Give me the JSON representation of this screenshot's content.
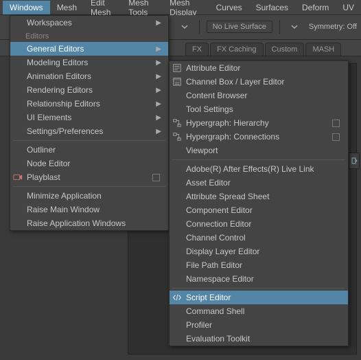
{
  "menubar": {
    "items": [
      {
        "label": "Windows",
        "active": true
      },
      {
        "label": "Mesh"
      },
      {
        "label": "Edit Mesh"
      },
      {
        "label": "Mesh Tools"
      },
      {
        "label": "Mesh Display"
      },
      {
        "label": "Curves"
      },
      {
        "label": "Surfaces"
      },
      {
        "label": "Deform"
      },
      {
        "label": "UV"
      }
    ]
  },
  "toolbar": {
    "live_surface": "No Live Surface",
    "symmetry": "Symmetry: Off"
  },
  "shelf": {
    "tabs": [
      "FX",
      "FX Caching",
      "Custom",
      "MASH"
    ]
  },
  "windows_menu": {
    "section_workspaces": "Workspaces",
    "section_editors": "Editors",
    "items_editors": [
      {
        "label": "General Editors",
        "arrow": true,
        "highlight": true
      },
      {
        "label": "Modeling Editors",
        "arrow": true
      },
      {
        "label": "Animation Editors",
        "arrow": true
      },
      {
        "label": "Rendering Editors",
        "arrow": true
      },
      {
        "label": "Relationship Editors",
        "arrow": true
      },
      {
        "label": "UI Elements",
        "arrow": true
      },
      {
        "label": "Settings/Preferences",
        "arrow": true
      }
    ],
    "items_mid": [
      {
        "label": "Outliner"
      },
      {
        "label": "Node Editor"
      },
      {
        "label": "Playblast",
        "option": true,
        "icon": "playblast"
      }
    ],
    "items_bottom": [
      {
        "label": "Minimize Application"
      },
      {
        "label": "Raise Main Window"
      },
      {
        "label": "Raise Application Windows"
      }
    ]
  },
  "general_editors_menu": {
    "items_top": [
      {
        "label": "Attribute Editor",
        "icon": "attr-editor"
      },
      {
        "label": "Channel Box / Layer Editor",
        "icon": "channel-box"
      },
      {
        "label": "Content Browser"
      },
      {
        "label": "Tool Settings"
      },
      {
        "label": "Hypergraph: Hierarchy",
        "icon": "hypergraph",
        "option": true
      },
      {
        "label": "Hypergraph: Connections",
        "icon": "hypergraph",
        "option": true
      },
      {
        "label": "Viewport"
      }
    ],
    "items_mid": [
      {
        "label": "Adobe(R) After Effects(R) Live Link"
      },
      {
        "label": "Asset Editor"
      },
      {
        "label": "Attribute Spread Sheet"
      },
      {
        "label": "Component Editor"
      },
      {
        "label": "Connection Editor"
      },
      {
        "label": "Channel Control"
      },
      {
        "label": "Display Layer Editor"
      },
      {
        "label": "File Path Editor"
      },
      {
        "label": "Namespace Editor"
      }
    ],
    "items_bottom": [
      {
        "label": "Script Editor",
        "icon": "script-editor",
        "highlight": true
      },
      {
        "label": "Command Shell"
      },
      {
        "label": "Profiler"
      },
      {
        "label": "Evaluation Toolkit"
      }
    ]
  }
}
